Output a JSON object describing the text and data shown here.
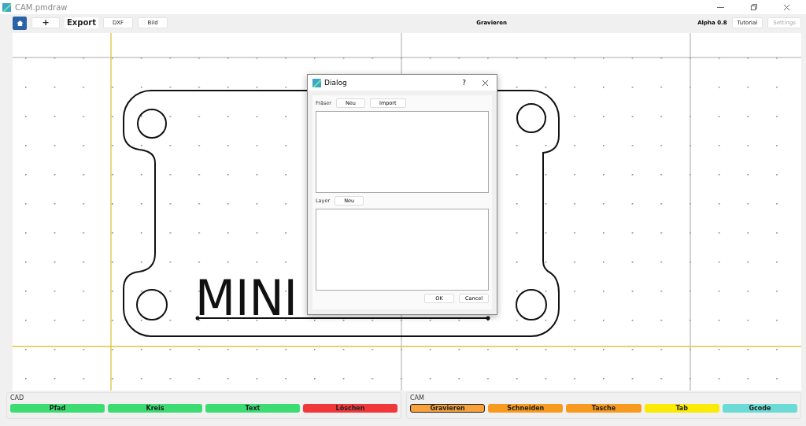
{
  "window": {
    "title": "CAM.pmdraw"
  },
  "toolbar": {
    "left_buttons": [
      {
        "label": "+",
        "kind": "plus"
      },
      {
        "label": "Export",
        "kind": "bold"
      },
      {
        "label": "DXF",
        "kind": "plain"
      },
      {
        "label": "Bild",
        "kind": "plain"
      }
    ],
    "mode_title": "Gravieren",
    "version": "Alpha 0.8",
    "right_buttons": [
      {
        "label": "Tutorial",
        "disabled": false
      },
      {
        "label": "Settings",
        "disabled": true
      }
    ]
  },
  "canvas": {
    "engraving_text": "MINI"
  },
  "dialog": {
    "title": "Dialog",
    "help": "?",
    "cutter_label": "Fräser",
    "cutter_buttons": [
      "Neu",
      "Import"
    ],
    "layer_label": "Layer",
    "layer_buttons": [
      "Neu"
    ],
    "buttons": [
      "OK",
      "Cancel"
    ]
  },
  "cad_panel": {
    "title": "CAD",
    "buttons": [
      {
        "label": "Pfad",
        "color": "#3ddc72",
        "selected": false
      },
      {
        "label": "Kreis",
        "color": "#3ddc72",
        "selected": false
      },
      {
        "label": "Text",
        "color": "#3ddc72",
        "selected": false
      },
      {
        "label": "Löschen",
        "color": "#f0383b",
        "selected": false
      }
    ]
  },
  "cam_panel": {
    "title": "CAM",
    "buttons": [
      {
        "label": "Gravieren",
        "color": "#f7a23a",
        "selected": true
      },
      {
        "label": "Schneiden",
        "color": "#f79a1f",
        "selected": false
      },
      {
        "label": "Tasche",
        "color": "#f79a1f",
        "selected": false
      },
      {
        "label": "Tab",
        "color": "#fbea05",
        "selected": false
      },
      {
        "label": "Gcode",
        "color": "#6cdbd6",
        "selected": false
      }
    ]
  }
}
